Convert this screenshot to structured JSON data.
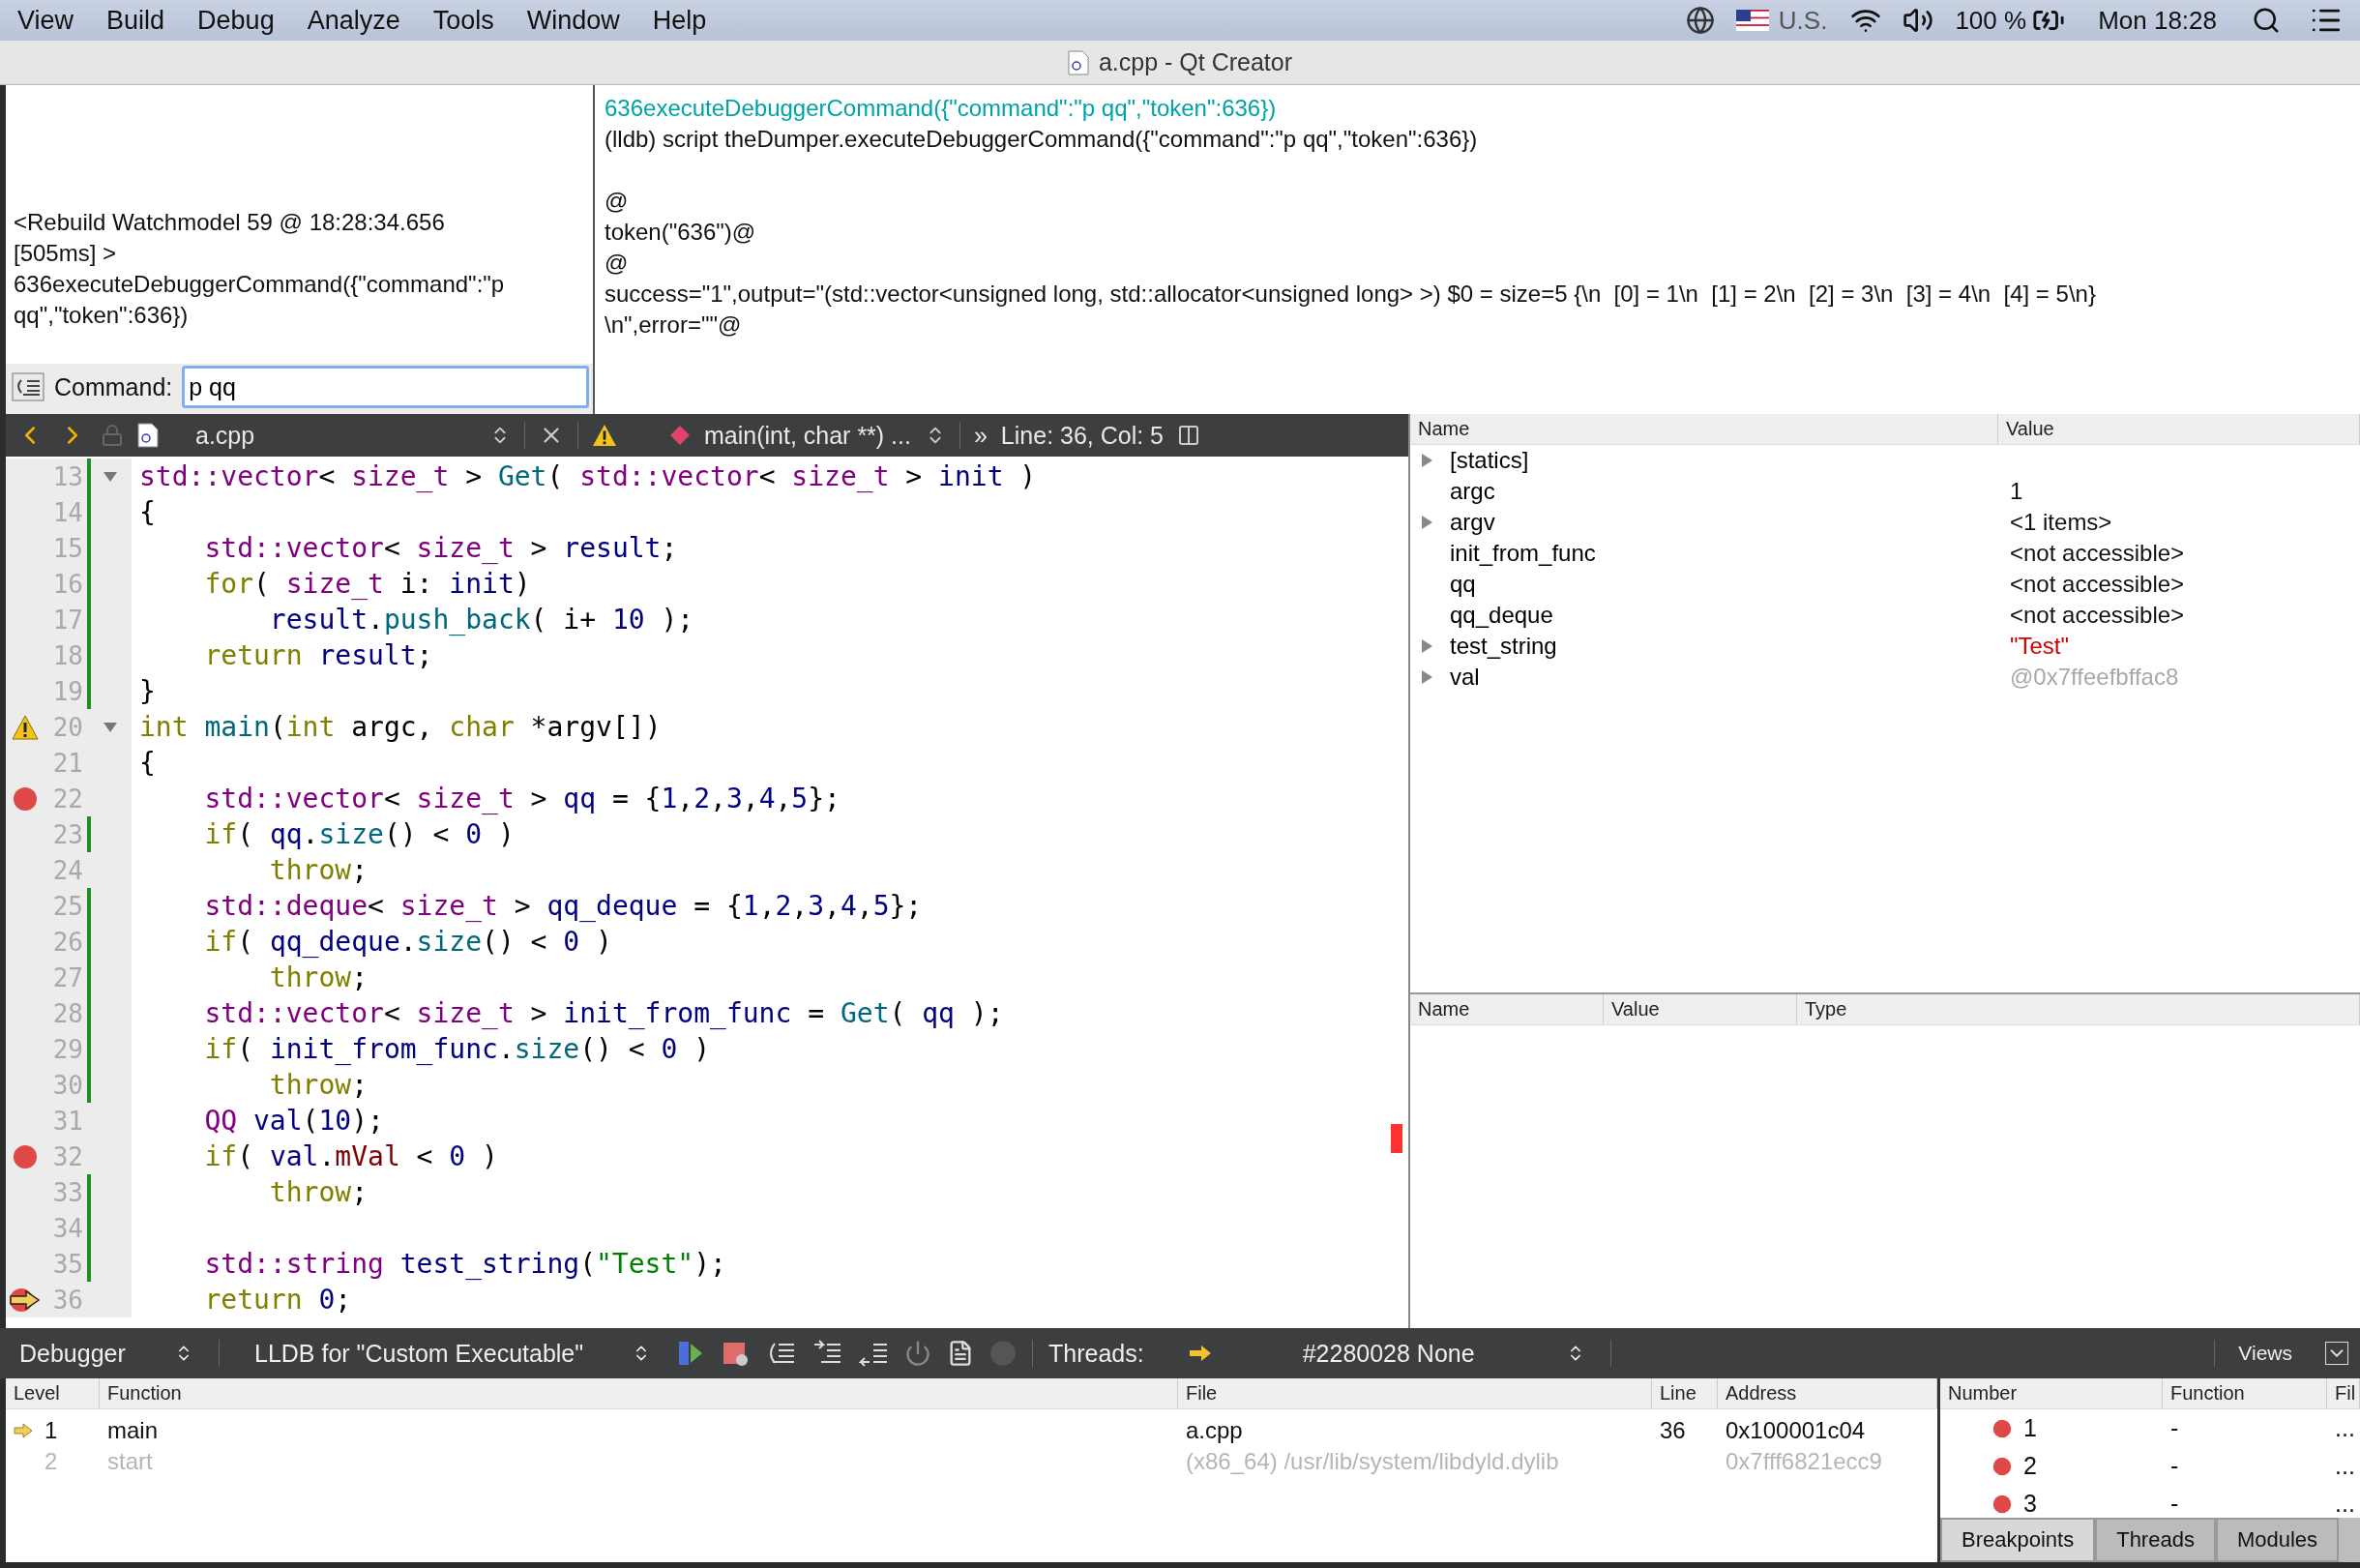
{
  "menu_bar": {
    "items": [
      "View",
      "Build",
      "Debug",
      "Analyze",
      "Tools",
      "Window",
      "Help"
    ],
    "input_source": "U.S.",
    "battery": "100 %",
    "clock": "Mon 18:28"
  },
  "window": {
    "title": "a.cpp - Qt Creator"
  },
  "log": {
    "left_lines": [
      "<Rebuild Watchmodel 59 @ 18:28:34.656",
      "[505ms] >",
      "636executeDebuggerCommand({\"command\":\"p",
      "qq\",\"token\":636})"
    ],
    "command_label": "Command:",
    "command_value": "p qq",
    "output_blocks": [
      [
        {
          "kind": "echo",
          "text": "636executeDebuggerCommand({\"command\":\"p qq\",\"token\":636})"
        },
        {
          "kind": "output",
          "text": "(lldb) script theDumper.executeDebuggerCommand({\"command\":\"p qq\",\"token\":636})"
        }
      ],
      [
        {
          "kind": "output",
          "text": "@"
        },
        {
          "kind": "output",
          "text": "token(\"636\")@"
        },
        {
          "kind": "output",
          "text": "@"
        },
        {
          "kind": "output",
          "text": "success=\"1\",output=\"(std::vector<unsigned long, std::allocator<unsigned long> >) $0 = size=5 {\\n  [0] = 1\\n  [1] = 2\\n  [2] = 3\\n  [3] = 4\\n  [4] = 5\\n}"
        },
        {
          "kind": "output",
          "text": "\\n\",error=\"\"@"
        }
      ]
    ]
  },
  "editor": {
    "toolbar": {
      "file": "a.cpp",
      "symbol": "main(int, char **) ...",
      "more": "»",
      "position": "Line: 36, Col: 5"
    },
    "lines": [
      {
        "number": "13",
        "fold": true,
        "changed": true,
        "tokens": [
          {
            "kind": "type",
            "text": "std::vector"
          },
          {
            "kind": "plain",
            "text": "< "
          },
          {
            "kind": "type",
            "text": "size_t"
          },
          {
            "kind": "plain",
            "text": " > "
          },
          {
            "kind": "func",
            "text": "Get"
          },
          {
            "kind": "plain",
            "text": "( "
          },
          {
            "kind": "type",
            "text": "std::vector"
          },
          {
            "kind": "plain",
            "text": "< "
          },
          {
            "kind": "type",
            "text": "size_t"
          },
          {
            "kind": "plain",
            "text": " > "
          },
          {
            "kind": "var",
            "text": "init"
          },
          {
            "kind": "plain",
            "text": " )"
          }
        ]
      },
      {
        "number": "14",
        "fold": false,
        "changed": true,
        "tokens": [
          {
            "kind": "plain",
            "text": "{"
          }
        ]
      },
      {
        "number": "15",
        "fold": false,
        "changed": true,
        "tokens": [
          {
            "kind": "type",
            "text": "    std::vector"
          },
          {
            "kind": "plain",
            "text": "< "
          },
          {
            "kind": "type",
            "text": "size_t"
          },
          {
            "kind": "plain",
            "text": " > "
          },
          {
            "kind": "var",
            "text": "result"
          },
          {
            "kind": "plain",
            "text": ";"
          }
        ]
      },
      {
        "number": "16",
        "fold": false,
        "changed": true,
        "tokens": [
          {
            "kind": "keyword",
            "text": "    for"
          },
          {
            "kind": "plain",
            "text": "( "
          },
          {
            "kind": "type",
            "text": "size_t"
          },
          {
            "kind": "plain",
            "text": " i: "
          },
          {
            "kind": "var",
            "text": "init"
          },
          {
            "kind": "plain",
            "text": ")"
          }
        ]
      },
      {
        "number": "17",
        "fold": false,
        "changed": true,
        "tokens": [
          {
            "kind": "var",
            "text": "        result"
          },
          {
            "kind": "plain",
            "text": "."
          },
          {
            "kind": "func",
            "text": "push_back"
          },
          {
            "kind": "plain",
            "text": "( i+ "
          },
          {
            "kind": "number",
            "text": "10"
          },
          {
            "kind": "plain",
            "text": " );"
          }
        ]
      },
      {
        "number": "18",
        "fold": false,
        "changed": true,
        "tokens": [
          {
            "kind": "keyword",
            "text": "    return "
          },
          {
            "kind": "var",
            "text": "result"
          },
          {
            "kind": "plain",
            "text": ";"
          }
        ]
      },
      {
        "number": "19",
        "fold": false,
        "changed": true,
        "tokens": [
          {
            "kind": "plain",
            "text": "}"
          }
        ]
      },
      {
        "number": "20",
        "fold": true,
        "changed": false,
        "kind": "warning",
        "tokens": [
          {
            "kind": "keyword",
            "text": "int "
          },
          {
            "kind": "func",
            "text": "main"
          },
          {
            "kind": "plain",
            "text": "("
          },
          {
            "kind": "keyword",
            "text": "int"
          },
          {
            "kind": "plain",
            "text": " argc, "
          },
          {
            "kind": "keyword",
            "text": "char"
          },
          {
            "kind": "plain",
            "text": " *argv[])"
          }
        ]
      },
      {
        "number": "21",
        "fold": false,
        "changed": false,
        "tokens": [
          {
            "kind": "plain",
            "text": "{"
          }
        ]
      },
      {
        "number": "22",
        "fold": false,
        "changed": false,
        "kind": "breakpoint",
        "tokens": [
          {
            "kind": "type",
            "text": "    std::vector"
          },
          {
            "kind": "plain",
            "text": "< "
          },
          {
            "kind": "type",
            "text": "size_t"
          },
          {
            "kind": "plain",
            "text": " > "
          },
          {
            "kind": "var",
            "text": "qq"
          },
          {
            "kind": "plain",
            "text": " = {"
          },
          {
            "kind": "number",
            "text": "1"
          },
          {
            "kind": "plain",
            "text": ","
          },
          {
            "kind": "number",
            "text": "2"
          },
          {
            "kind": "plain",
            "text": ","
          },
          {
            "kind": "number",
            "text": "3"
          },
          {
            "kind": "plain",
            "text": ","
          },
          {
            "kind": "number",
            "text": "4"
          },
          {
            "kind": "plain",
            "text": ","
          },
          {
            "kind": "number",
            "text": "5"
          },
          {
            "kind": "plain",
            "text": "};"
          }
        ]
      },
      {
        "number": "23",
        "fold": false,
        "changed": true,
        "tokens": [
          {
            "kind": "keyword",
            "text": "    if"
          },
          {
            "kind": "plain",
            "text": "( "
          },
          {
            "kind": "var",
            "text": "qq"
          },
          {
            "kind": "plain",
            "text": "."
          },
          {
            "kind": "func",
            "text": "size"
          },
          {
            "kind": "plain",
            "text": "() < "
          },
          {
            "kind": "number",
            "text": "0"
          },
          {
            "kind": "plain",
            "text": " )"
          }
        ]
      },
      {
        "number": "24",
        "fold": false,
        "changed": false,
        "tokens": [
          {
            "kind": "keyword",
            "text": "        throw"
          },
          {
            "kind": "plain",
            "text": ";"
          }
        ]
      },
      {
        "number": "25",
        "fold": false,
        "changed": true,
        "tokens": [
          {
            "kind": "type",
            "text": "    std::deque"
          },
          {
            "kind": "plain",
            "text": "< "
          },
          {
            "kind": "type",
            "text": "size_t"
          },
          {
            "kind": "plain",
            "text": " > "
          },
          {
            "kind": "var",
            "text": "qq_deque"
          },
          {
            "kind": "plain",
            "text": " = {"
          },
          {
            "kind": "number",
            "text": "1"
          },
          {
            "kind": "plain",
            "text": ","
          },
          {
            "kind": "number",
            "text": "2"
          },
          {
            "kind": "plain",
            "text": ","
          },
          {
            "kind": "number",
            "text": "3"
          },
          {
            "kind": "plain",
            "text": ","
          },
          {
            "kind": "number",
            "text": "4"
          },
          {
            "kind": "plain",
            "text": ","
          },
          {
            "kind": "number",
            "text": "5"
          },
          {
            "kind": "plain",
            "text": "};"
          }
        ]
      },
      {
        "number": "26",
        "fold": false,
        "changed": true,
        "tokens": [
          {
            "kind": "keyword",
            "text": "    if"
          },
          {
            "kind": "plain",
            "text": "( "
          },
          {
            "kind": "var",
            "text": "qq_deque"
          },
          {
            "kind": "plain",
            "text": "."
          },
          {
            "kind": "func",
            "text": "size"
          },
          {
            "kind": "plain",
            "text": "() < "
          },
          {
            "kind": "number",
            "text": "0"
          },
          {
            "kind": "plain",
            "text": " )"
          }
        ]
      },
      {
        "number": "27",
        "fold": false,
        "changed": true,
        "tokens": [
          {
            "kind": "keyword",
            "text": "        throw"
          },
          {
            "kind": "plain",
            "text": ";"
          }
        ]
      },
      {
        "number": "28",
        "fold": false,
        "changed": true,
        "tokens": [
          {
            "kind": "type",
            "text": "    std::vector"
          },
          {
            "kind": "plain",
            "text": "< "
          },
          {
            "kind": "type",
            "text": "size_t"
          },
          {
            "kind": "plain",
            "text": " > "
          },
          {
            "kind": "var",
            "text": "init_from_func"
          },
          {
            "kind": "plain",
            "text": " = "
          },
          {
            "kind": "func",
            "text": "Get"
          },
          {
            "kind": "plain",
            "text": "( "
          },
          {
            "kind": "var",
            "text": "qq"
          },
          {
            "kind": "plain",
            "text": " );"
          }
        ]
      },
      {
        "number": "29",
        "fold": false,
        "changed": true,
        "tokens": [
          {
            "kind": "keyword",
            "text": "    if"
          },
          {
            "kind": "plain",
            "text": "( "
          },
          {
            "kind": "var",
            "text": "init_from_func"
          },
          {
            "kind": "plain",
            "text": "."
          },
          {
            "kind": "func",
            "text": "size"
          },
          {
            "kind": "plain",
            "text": "() < "
          },
          {
            "kind": "number",
            "text": "0"
          },
          {
            "kind": "plain",
            "text": " )"
          }
        ]
      },
      {
        "number": "30",
        "fold": false,
        "changed": true,
        "tokens": [
          {
            "kind": "keyword",
            "text": "        throw"
          },
          {
            "kind": "plain",
            "text": ";"
          }
        ]
      },
      {
        "number": "31",
        "fold": false,
        "changed": false,
        "tokens": [
          {
            "kind": "type",
            "text": "    QQ "
          },
          {
            "kind": "var",
            "text": "val"
          },
          {
            "kind": "plain",
            "text": "("
          },
          {
            "kind": "number",
            "text": "10"
          },
          {
            "kind": "plain",
            "text": ");"
          }
        ]
      },
      {
        "number": "32",
        "fold": false,
        "changed": false,
        "kind": "breakpoint",
        "tokens": [
          {
            "kind": "keyword",
            "text": "    if"
          },
          {
            "kind": "plain",
            "text": "( "
          },
          {
            "kind": "var",
            "text": "val"
          },
          {
            "kind": "plain",
            "text": "."
          },
          {
            "kind": "member",
            "text": "mVal"
          },
          {
            "kind": "plain",
            "text": " < "
          },
          {
            "kind": "number",
            "text": "0"
          },
          {
            "kind": "plain",
            "text": " )"
          }
        ]
      },
      {
        "number": "33",
        "fold": false,
        "changed": true,
        "tokens": [
          {
            "kind": "keyword",
            "text": "        throw"
          },
          {
            "kind": "plain",
            "text": ";"
          }
        ]
      },
      {
        "number": "34",
        "fold": false,
        "changed": true
      },
      {
        "number": "35",
        "fold": false,
        "changed": true,
        "tokens": [
          {
            "kind": "type",
            "text": "    std::string "
          },
          {
            "kind": "var",
            "text": "test_string"
          },
          {
            "kind": "plain",
            "text": "("
          },
          {
            "kind": "string",
            "text": "\"Test\""
          },
          {
            "kind": "plain",
            "text": ");"
          }
        ]
      },
      {
        "number": "36",
        "fold": false,
        "changed": false,
        "kind": "current",
        "tokens": [
          {
            "kind": "keyword",
            "text": "    return "
          },
          {
            "kind": "number",
            "text": "0"
          },
          {
            "kind": "plain",
            "text": ";"
          }
        ]
      }
    ]
  },
  "locals": {
    "columns": [
      "Name",
      "Value"
    ],
    "rows": [
      {
        "name": "[statics]",
        "expandable": true
      },
      {
        "name": "argc",
        "value": "1",
        "kind": "plain",
        "expandable": false
      },
      {
        "name": "argv",
        "value": "<1 items>",
        "kind": "plain",
        "expandable": true
      },
      {
        "name": "init_from_func",
        "value": "<not accessible>",
        "kind": "plain",
        "expandable": false
      },
      {
        "name": "qq",
        "value": "<not accessible>",
        "kind": "plain",
        "expandable": false
      },
      {
        "name": "qq_deque",
        "value": "<not accessible>",
        "kind": "plain",
        "expandable": false
      },
      {
        "name": "test_string",
        "value": "\"Test\"",
        "kind": "string",
        "expandable": true
      },
      {
        "name": "val",
        "value": "@0x7ffeefbffac8",
        "kind": "address",
        "expandable": true
      }
    ]
  },
  "watchers": {
    "columns": [
      "Name",
      "Value",
      "Type"
    ]
  },
  "debugger_toolbar": {
    "engine": "Debugger",
    "target": "LLDB for \"Custom Executable\"",
    "threads_label": "Threads:",
    "thread": "#2280028 None",
    "views": "Views"
  },
  "stack": {
    "columns": [
      "Level",
      "Function",
      "File",
      "Line",
      "Address"
    ],
    "rows": [
      {
        "level": "1",
        "function": "main",
        "file": "a.cpp",
        "line": "36",
        "address": "0x100001c04",
        "current": true,
        "dimmed": false
      },
      {
        "level": "2",
        "function": "start",
        "file": "(x86_64) /usr/lib/system/libdyld.dylib",
        "address": "0x7fff6821ecc9",
        "current": false,
        "dimmed": true
      }
    ]
  },
  "breakpoints": {
    "columns": [
      "Number",
      "Function",
      "Fil"
    ],
    "rows": [
      {
        "number": "1",
        "function": "-",
        "file": "..."
      },
      {
        "number": "2",
        "function": "-",
        "file": "..."
      },
      {
        "number": "3",
        "function": "-",
        "file": "..."
      }
    ],
    "tabs": [
      {
        "label": "Breakpoints",
        "selected": true
      },
      {
        "label": "Threads",
        "selected": false
      },
      {
        "label": "Modules",
        "selected": false
      }
    ]
  }
}
